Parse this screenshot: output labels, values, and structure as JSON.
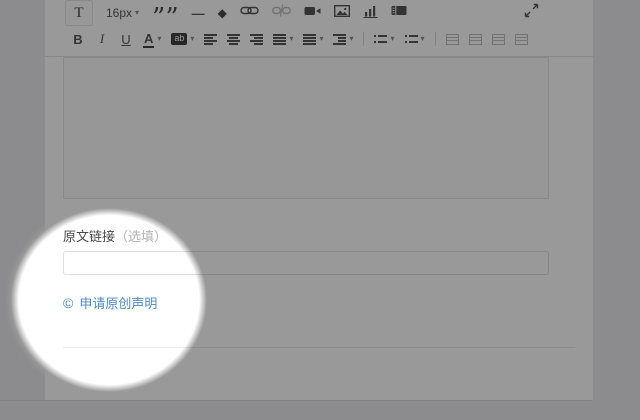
{
  "editor": {
    "toolbar_row1": [
      {
        "name": "text-style",
        "kind": "button",
        "label": "T"
      },
      {
        "name": "font-size",
        "kind": "fontsize",
        "label": "16px",
        "caret": true
      },
      {
        "name": "blockquote",
        "kind": "quote",
        "glyph": "”"
      },
      {
        "name": "horizontal-rule",
        "kind": "dash",
        "glyph": "—"
      },
      {
        "name": "format-eraser",
        "kind": "diamond",
        "glyph": "◆"
      },
      {
        "name": "insert-link",
        "kind": "svg",
        "svg": "link"
      },
      {
        "name": "remove-link",
        "kind": "svg",
        "svg": "unlink",
        "disabled": true
      },
      {
        "name": "insert-video",
        "kind": "svg",
        "svg": "video"
      },
      {
        "name": "insert-image",
        "kind": "svg",
        "svg": "image"
      },
      {
        "name": "insert-chart",
        "kind": "svg",
        "svg": "chart"
      },
      {
        "name": "insert-media",
        "kind": "svg",
        "svg": "film"
      }
    ],
    "toolbar_row2": [
      {
        "name": "bold",
        "kind": "letter",
        "label": "B",
        "style": "bold"
      },
      {
        "name": "italic",
        "kind": "letter",
        "label": "I",
        "style": "italic"
      },
      {
        "name": "underline",
        "kind": "letter",
        "label": "U",
        "style": "underline"
      },
      {
        "name": "font-color",
        "kind": "letter",
        "label": "A",
        "style": "color",
        "caret": true
      },
      {
        "name": "background-color",
        "kind": "swatch",
        "label": "ab",
        "caret": true
      },
      {
        "name": "align-left",
        "kind": "bars",
        "bars": "left"
      },
      {
        "name": "align-center",
        "kind": "bars",
        "bars": "center"
      },
      {
        "name": "align-right",
        "kind": "bars",
        "bars": "right"
      },
      {
        "name": "align-justify",
        "kind": "bars",
        "bars": "justify",
        "caret": true
      },
      {
        "name": "line-height",
        "kind": "bars",
        "bars": "lineheight",
        "caret": true
      },
      {
        "name": "indent",
        "kind": "bars",
        "bars": "indent",
        "caret": true
      },
      {
        "kind": "sep"
      },
      {
        "name": "ordered-list",
        "kind": "bars",
        "bars": "ol",
        "caret": true
      },
      {
        "name": "unordered-list",
        "kind": "bars",
        "bars": "ul",
        "caret": true
      },
      {
        "kind": "sep"
      },
      {
        "name": "table-tool-1",
        "kind": "bars",
        "bars": "grid",
        "disabled": true
      },
      {
        "name": "table-tool-2",
        "kind": "bars",
        "bars": "grid",
        "disabled": true
      },
      {
        "name": "table-tool-3",
        "kind": "bars",
        "bars": "grid",
        "disabled": true
      },
      {
        "name": "table-tool-4",
        "kind": "bars",
        "bars": "grid",
        "disabled": true
      }
    ],
    "fullscreen_icon": "expand",
    "body_text": ""
  },
  "source_section": {
    "label": "原文链接",
    "optional_hint": "（选填）",
    "input_value": "",
    "input_placeholder": "",
    "copyright_glyph": "©",
    "original_claim_link": "申请原创声明"
  },
  "colors": {
    "link_blue": "#4e8bc0",
    "dim_overlay": "rgba(0,0,0,0.4)",
    "card_background": "#ffffff",
    "page_background": "#eaeaec"
  }
}
